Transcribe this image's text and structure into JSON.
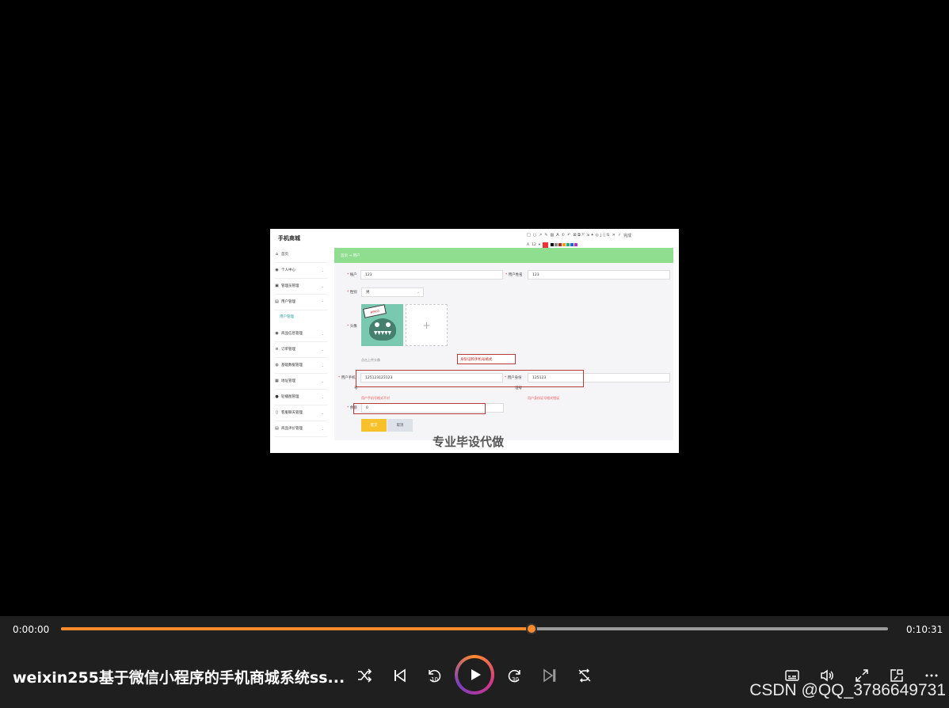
{
  "frame": {
    "app_title": "手机商城",
    "sidebar": [
      {
        "icon": "home-icon",
        "label": "首页"
      },
      {
        "icon": "user-icon",
        "label": "个人中心"
      },
      {
        "icon": "admin-icon",
        "label": "管理员管理"
      },
      {
        "icon": "users-icon",
        "label": "用户管理"
      },
      {
        "icon": "goods-icon",
        "label": "商品信息管理"
      },
      {
        "icon": "order-icon",
        "label": "订单管理"
      },
      {
        "icon": "data-icon",
        "label": "基础数据管理"
      },
      {
        "icon": "address-icon",
        "label": "地址管理"
      },
      {
        "icon": "carousel-icon",
        "label": "轮播图管理"
      },
      {
        "icon": "chat-icon",
        "label": "客服聊天管理"
      },
      {
        "icon": "review-icon",
        "label": "商品评价管理"
      }
    ],
    "sidebar_sub": "用户管理",
    "breadcrumb": "首页  →  用户",
    "form": {
      "account_label": "账户",
      "account_value": "123",
      "username_label": "用户姓名",
      "username_value": "123",
      "gender_label": "性别",
      "gender_value": "男",
      "avatar_label": "头像",
      "avatar_sign": "ЯPHO",
      "upload_plus": "+",
      "upload_hint": "点击上传头像",
      "phone_label": "用户手机",
      "phone_label_wrap": "号",
      "phone_value": "125123123123",
      "phone_error": "用户手机号格式不对",
      "idcard_label": "用户身份",
      "idcard_label_wrap": "证号",
      "idcard_value": "125123",
      "idcard_error": "用户身份证号格式错误",
      "balance_label": "余额",
      "balance_value": "0",
      "submit_label": "提交",
      "cancel_label": "取消"
    },
    "annotation_text": "身份证和手机号格式",
    "annotation_font_size": "12",
    "annotation_done": "完成",
    "watermark": "专业毕设代做"
  },
  "player": {
    "current_time": "0:00:00",
    "total_time": "0:10:31",
    "progress_fraction": 0.569,
    "video_title": "weixin255基于微信小程序的手机商城系统ss...",
    "watermark": "CSDN @QQ_3786649731",
    "accent": "#ff8a2b"
  }
}
